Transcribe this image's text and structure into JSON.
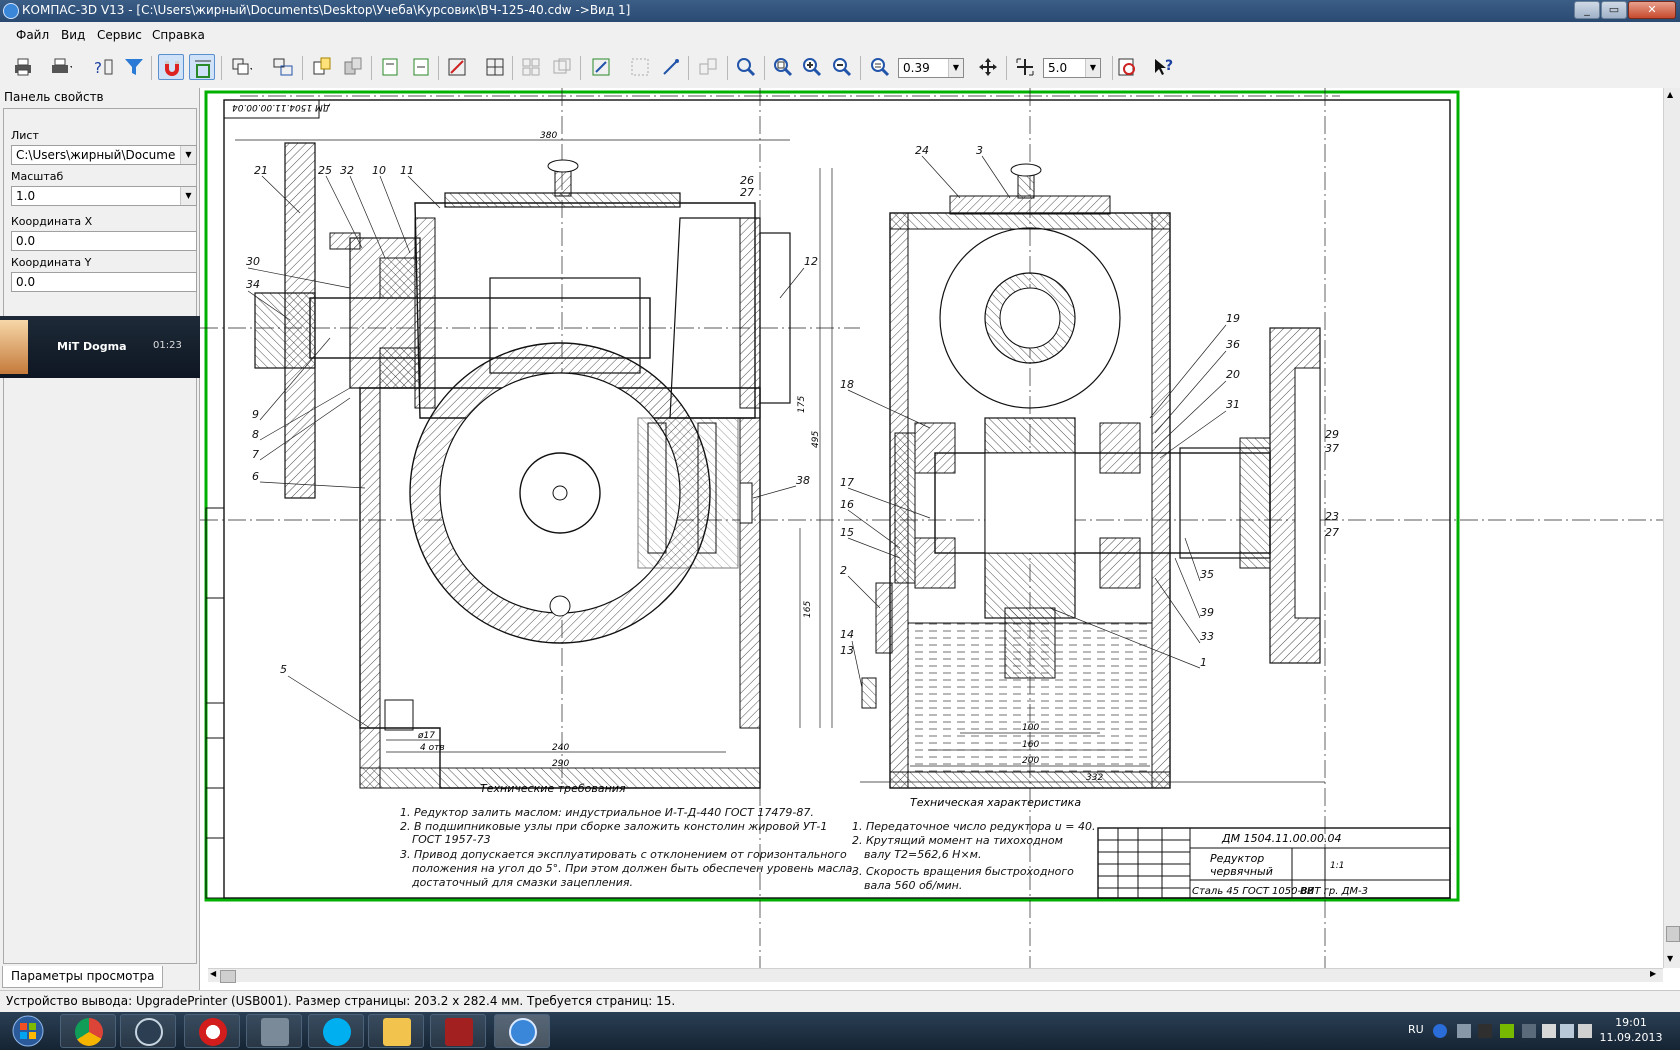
{
  "window": {
    "title": "КОМПАС-3D V13 - [C:\\Users\\жирный\\Documents\\Desktop\\Учеба\\Курсовик\\ВЧ-125-40.cdw ->Вид 1]"
  },
  "menu": [
    "Файл",
    "Вид",
    "Сервис",
    "Справка"
  ],
  "toolbar": {
    "zoom_value": "0.39",
    "step_value": "5.0"
  },
  "properties_panel": {
    "title": "Панель свойств",
    "sheet_label": "Лист",
    "sheet_value": "C:\\Users\\жирный\\Documents",
    "scale_label": "Масштаб",
    "scale_value": "1.0",
    "coord_x_label": "Координата X",
    "coord_x_value": "0.0",
    "coord_y_label": "Координата Y",
    "coord_y_value": "0.0",
    "bottom_tab": "Параметры просмотра"
  },
  "notification": {
    "name": "MiT Dogma",
    "time": "01:23"
  },
  "drawing": {
    "stamp_top": "ДМ 1504.11.00.00.04",
    "tech_requirements_title": "Технические требования",
    "tech_requirements": [
      "1. Редуктор залить маслом: индустриальное И-Т-Д-440 ГОСТ 17479-87.",
      "2. В подшипниковые узлы при сборке заложить констолин жировой УТ-1",
      "ГОСТ 1957-73",
      "3. Привод допускается эксплуатировать с отклонением от горизонтального",
      "положения на угол до 5°. При этом должен быть обеспечен уровень масла,",
      "достаточный для смазки зацепления."
    ],
    "tech_char_title": "Техническая характеристика",
    "tech_char": [
      "1. Передаточное число редуктора u = 40.",
      "2. Крутящий момент на тихоходном",
      "валу T2=562,6 Н×м.",
      "3. Скорость вращения быстроходного",
      "вала 560 об/мин."
    ],
    "title_block": {
      "designation": "ДМ 1504.11.00.00.04",
      "name_line1": "Редуктор",
      "name_line2": "червячный",
      "material": "Сталь 45 ГОСТ 1050-88",
      "org": "ВИТ гр. ДМ-3",
      "scale": "1:1"
    },
    "dimensions": {
      "d380": "380",
      "d240": "240",
      "d290": "290",
      "d100": "100",
      "d160": "160",
      "d200": "200",
      "d332": "332",
      "d17": "ø17",
      "holes": "4 отв",
      "v175": "175",
      "v495": "495",
      "v165": "165"
    },
    "callouts_left": [
      "21",
      "25",
      "32",
      "10",
      "11",
      "26",
      "27",
      "12",
      "30",
      "34",
      "9",
      "8",
      "7",
      "6",
      "5",
      "38"
    ],
    "callouts_right": [
      "24",
      "3",
      "19",
      "36",
      "20",
      "31",
      "18",
      "17",
      "16",
      "15",
      "2",
      "14",
      "13",
      "29",
      "37",
      "23",
      "27",
      "35",
      "39",
      "33",
      "1"
    ]
  },
  "status": {
    "text": "Устройство вывода: UpgradePrinter (USB001). Размер страницы: 203.2 x 282.4 мм. Требуется страниц: 15."
  },
  "taskbar": {
    "lang": "RU",
    "time": "19:01",
    "date": "11.09.2013"
  }
}
